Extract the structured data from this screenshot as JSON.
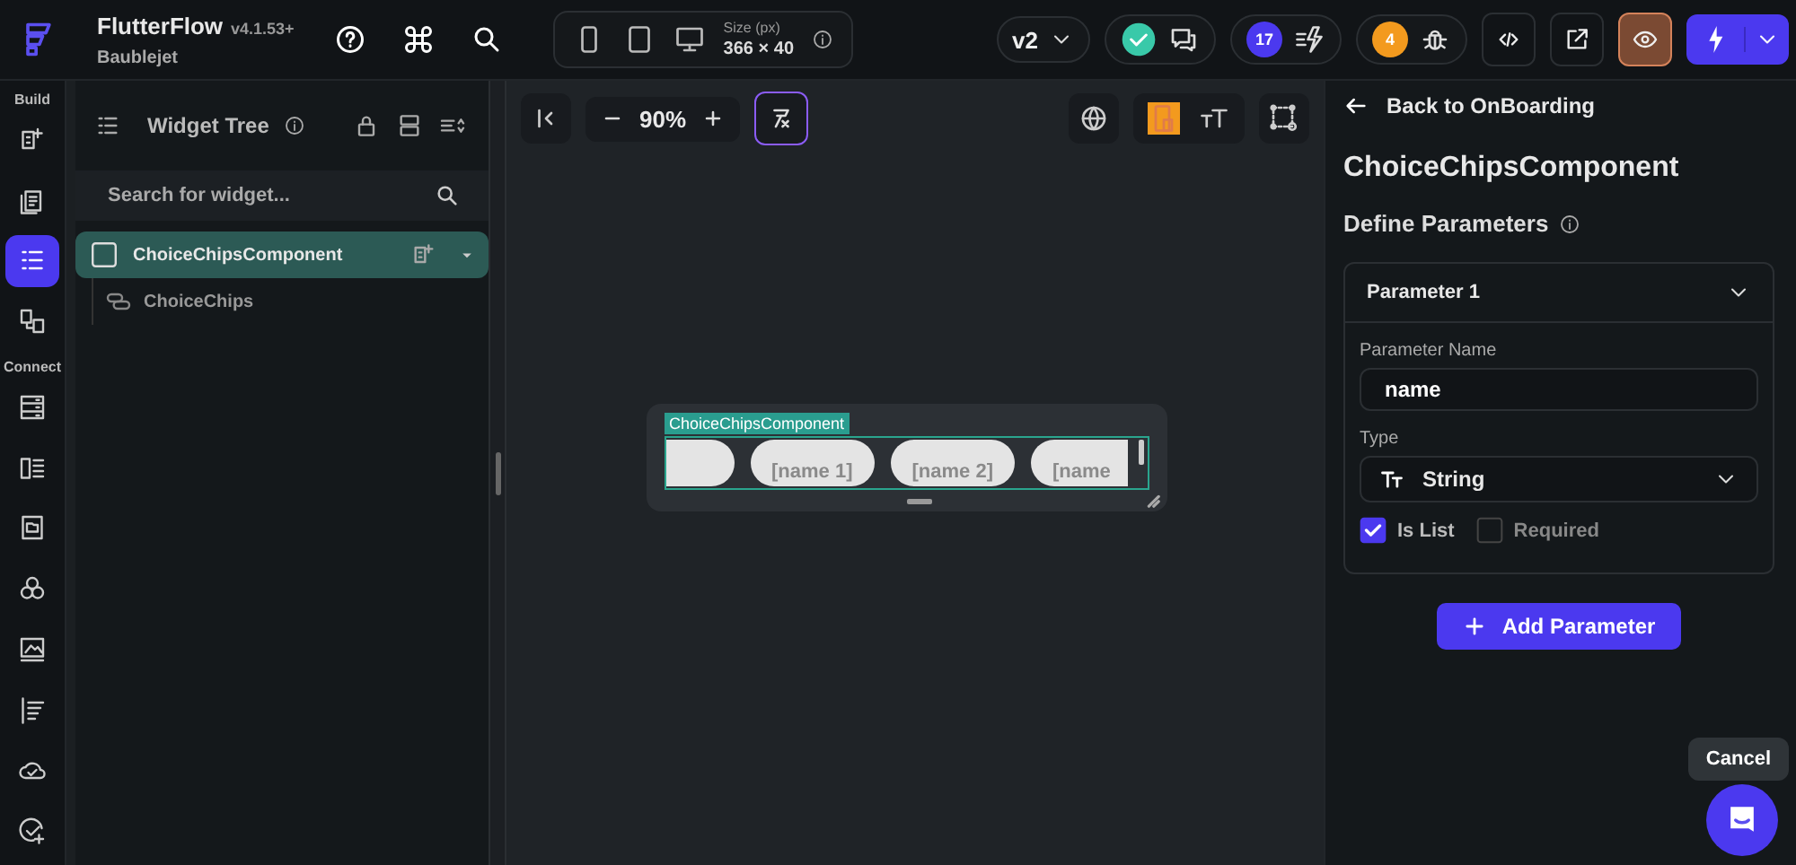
{
  "app": {
    "name": "FlutterFlow",
    "version": "v4.1.53+",
    "project": "Baublejet"
  },
  "device_bar": {
    "size_label": "Size (px)",
    "size_value": "366 × 40"
  },
  "top_actions": {
    "version": "v2",
    "issues_count": "17",
    "bugs_count": "4",
    "preview_on": true
  },
  "rail": {
    "sections": [
      {
        "label": "Build",
        "items": [
          {
            "kind": "add",
            "selected": false
          },
          {
            "kind": "pages",
            "selected": false
          },
          {
            "kind": "tree",
            "selected": true
          },
          {
            "kind": "story",
            "selected": false
          }
        ]
      },
      {
        "label": "Connect",
        "items": [
          {
            "kind": "database",
            "selected": false
          },
          {
            "kind": "list",
            "selected": false
          },
          {
            "kind": "folder",
            "selected": false
          },
          {
            "kind": "theme",
            "selected": false
          },
          {
            "kind": "image",
            "selected": false
          },
          {
            "kind": "align",
            "selected": false
          },
          {
            "kind": "cloud",
            "selected": false
          },
          {
            "kind": "test",
            "selected": false
          }
        ]
      }
    ]
  },
  "widget_tree": {
    "title": "Widget Tree",
    "search": {
      "placeholder": "Search for widget..."
    },
    "nodes": [
      {
        "label": "ChoiceChipsComponent",
        "selected": true,
        "children": [
          {
            "label": "ChoiceChips",
            "selected": false
          }
        ]
      }
    ]
  },
  "canvas": {
    "zoom": "90%",
    "component_label": "ChoiceChipsComponent",
    "chips": [
      "[name 1]",
      "[name 2]",
      "[name"
    ]
  },
  "properties": {
    "back_link": "Back to OnBoarding",
    "title": "ChoiceChipsComponent",
    "section": "Define Parameters",
    "parameters": [
      {
        "header": "Parameter 1",
        "expanded": true,
        "name_label": "Parameter Name",
        "name_value": "name",
        "type_label": "Type",
        "type_value": "String",
        "options": [
          {
            "label": "Is List",
            "checked": true
          },
          {
            "label": "Required",
            "checked": false
          }
        ]
      }
    ],
    "add_button": "Add Parameter"
  },
  "tooltip": "Cancel"
}
